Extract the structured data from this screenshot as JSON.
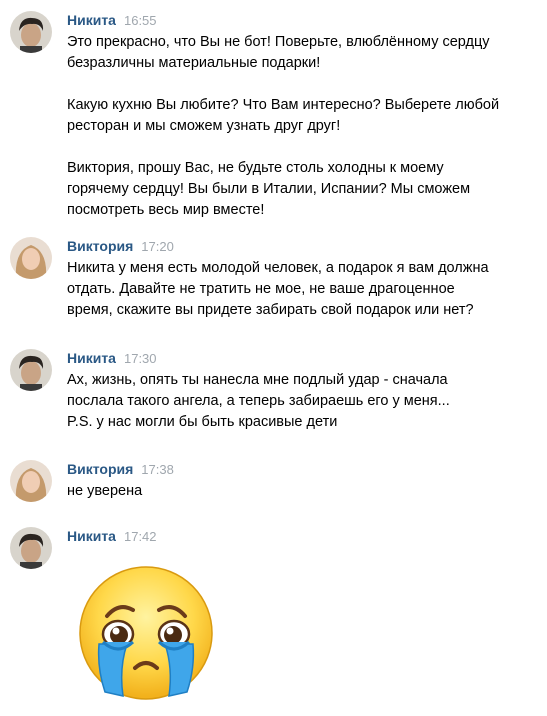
{
  "messages": [
    {
      "author": "Никита",
      "time": "16:55",
      "paragraphs": [
        [
          "Это прекрасно, что Вы не бот! Поверьте, влюблённому сердцу",
          "безразличны материальные подарки!"
        ],
        [
          "Какую кухню Вы любите? Что Вам интересно? Выберете любой",
          "ресторан и мы сможем узнать друг друг!"
        ],
        [
          "Виктория, прошу Вас, не будьте столь холодны к моему",
          "горячему сердцу! Вы были в Италии, Испании? Мы сможем",
          "посмотреть весь мир вместе!"
        ]
      ]
    },
    {
      "author": "Виктория",
      "time": "17:20",
      "paragraphs": [
        [
          "Никита у меня есть молодой человек, а подарок я вам должна",
          "отдать. Давайте не тратить не мое, не ваше драгоценное",
          "время, скажите вы придете забирать свой подарок или нет?"
        ]
      ]
    },
    {
      "author": "Никита",
      "time": "17:30",
      "paragraphs": [
        [
          "Ах, жизнь, опять ты нанесла мне подлый удар - сначала",
          "послала такого ангела, а теперь забираешь его у меня...",
          "P.S. у нас могли бы быть красивые дети"
        ]
      ]
    },
    {
      "author": "Виктория",
      "time": "17:38",
      "paragraphs": [
        [
          "не уверена"
        ]
      ]
    },
    {
      "author": "Никита",
      "time": "17:42",
      "sticker": "crying-face-sticker"
    }
  ],
  "colors": {
    "author": "#2a5885",
    "time": "#a0a7ae",
    "text": "#000000",
    "background": "#ffffff"
  }
}
